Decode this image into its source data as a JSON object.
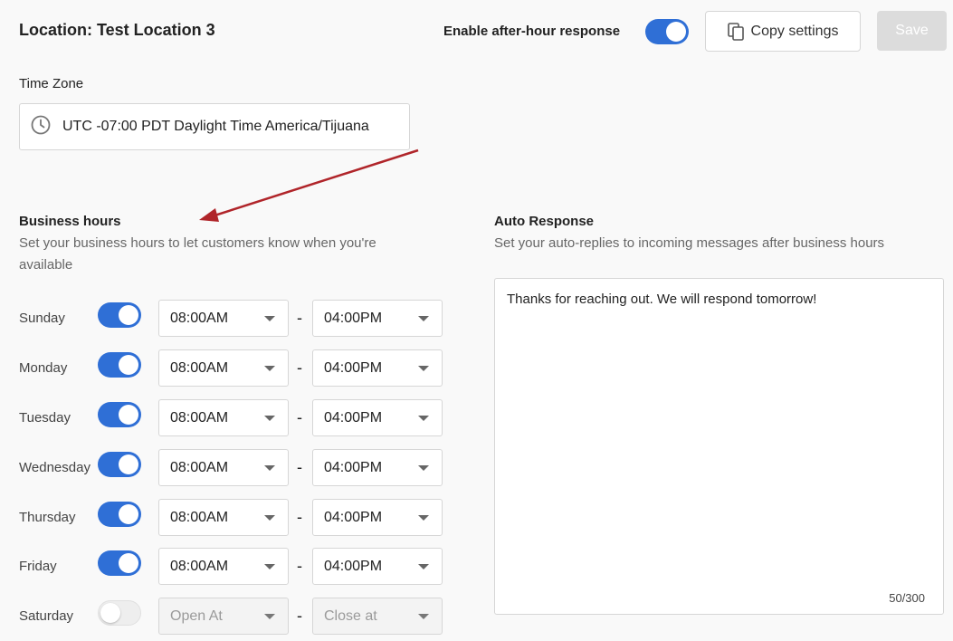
{
  "header": {
    "location_title": "Location: Test Location 3",
    "after_hour_label": "Enable after-hour response",
    "after_hour_enabled": true,
    "copy_label": "Copy settings",
    "save_label": "Save"
  },
  "timezone": {
    "label": "Time Zone",
    "value": "UTC -07:00 PDT Daylight Time America/Tijuana"
  },
  "business_hours": {
    "title": "Business hours",
    "description_line1": "Set your business hours to let customers know when you're",
    "description_line2": "available",
    "separator": "-",
    "days": [
      {
        "day": "Sunday",
        "enabled": true,
        "open": "08:00AM",
        "close": "04:00PM"
      },
      {
        "day": "Monday",
        "enabled": true,
        "open": "08:00AM",
        "close": "04:00PM"
      },
      {
        "day": "Tuesday",
        "enabled": true,
        "open": "08:00AM",
        "close": "04:00PM"
      },
      {
        "day": "Wednesday",
        "enabled": true,
        "open": "08:00AM",
        "close": "04:00PM"
      },
      {
        "day": "Thursday",
        "enabled": true,
        "open": "08:00AM",
        "close": "04:00PM"
      },
      {
        "day": "Friday",
        "enabled": true,
        "open": "08:00AM",
        "close": "04:00PM"
      },
      {
        "day": "Saturday",
        "enabled": false,
        "open": "Open At",
        "close": "Close at"
      }
    ]
  },
  "auto_response": {
    "title": "Auto Response",
    "description": "Set your auto-replies to incoming messages after business hours",
    "message": "Thanks for reaching out. We will respond tomorrow!",
    "char_count": "50/300"
  },
  "colors": {
    "toggle_on": "#2f6fd6",
    "annotation_arrow": "#b0252a"
  },
  "icons": {
    "copy": "copy-icon",
    "clock": "clock-icon",
    "dropdown": "chevron-down-icon"
  }
}
